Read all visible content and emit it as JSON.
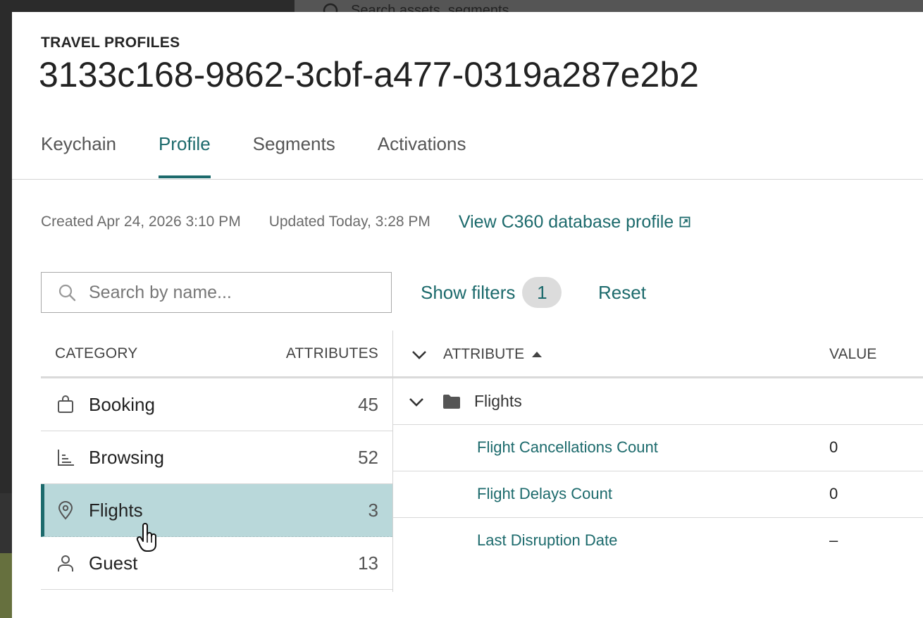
{
  "backdrop": {
    "search_text": "Search assets, segments"
  },
  "header": {
    "eyebrow": "TRAVEL PROFILES",
    "title": "3133c168-9862-3cbf-a477-0319a287e2b2"
  },
  "tabs": [
    {
      "label": "Keychain",
      "active": false
    },
    {
      "label": "Profile",
      "active": true
    },
    {
      "label": "Segments",
      "active": false
    },
    {
      "label": "Activations",
      "active": false
    }
  ],
  "meta": {
    "created": "Created Apr 24, 2026 3:10 PM",
    "updated": "Updated Today, 3:28 PM",
    "link_label": "View C360 database profile"
  },
  "search": {
    "placeholder": "Search by name...",
    "value": ""
  },
  "filters": {
    "show_label": "Show filters",
    "count": "1",
    "reset_label": "Reset"
  },
  "categories": {
    "header_category": "CATEGORY",
    "header_attributes": "ATTRIBUTES",
    "items": [
      {
        "name": "Booking",
        "count": "45",
        "icon": "shopping-bag-icon",
        "selected": false
      },
      {
        "name": "Browsing",
        "count": "52",
        "icon": "bar-chart-icon",
        "selected": false
      },
      {
        "name": "Flights",
        "count": "3",
        "icon": "location-pin-icon",
        "selected": true
      },
      {
        "name": "Guest",
        "count": "13",
        "icon": "person-icon",
        "selected": false
      }
    ]
  },
  "attributes": {
    "header_attribute": "ATTRIBUTE",
    "header_value": "VALUE",
    "sort": "ascending",
    "group": "Flights",
    "rows": [
      {
        "name": "Flight Cancellations Count",
        "value": "0"
      },
      {
        "name": "Flight Delays Count",
        "value": "0"
      },
      {
        "name": "Last Disruption Date",
        "value": "–"
      }
    ]
  },
  "colors": {
    "accent": "#1c6a6c",
    "selected_row": "#b9d8da",
    "badge_bg": "#dcdcdc"
  }
}
